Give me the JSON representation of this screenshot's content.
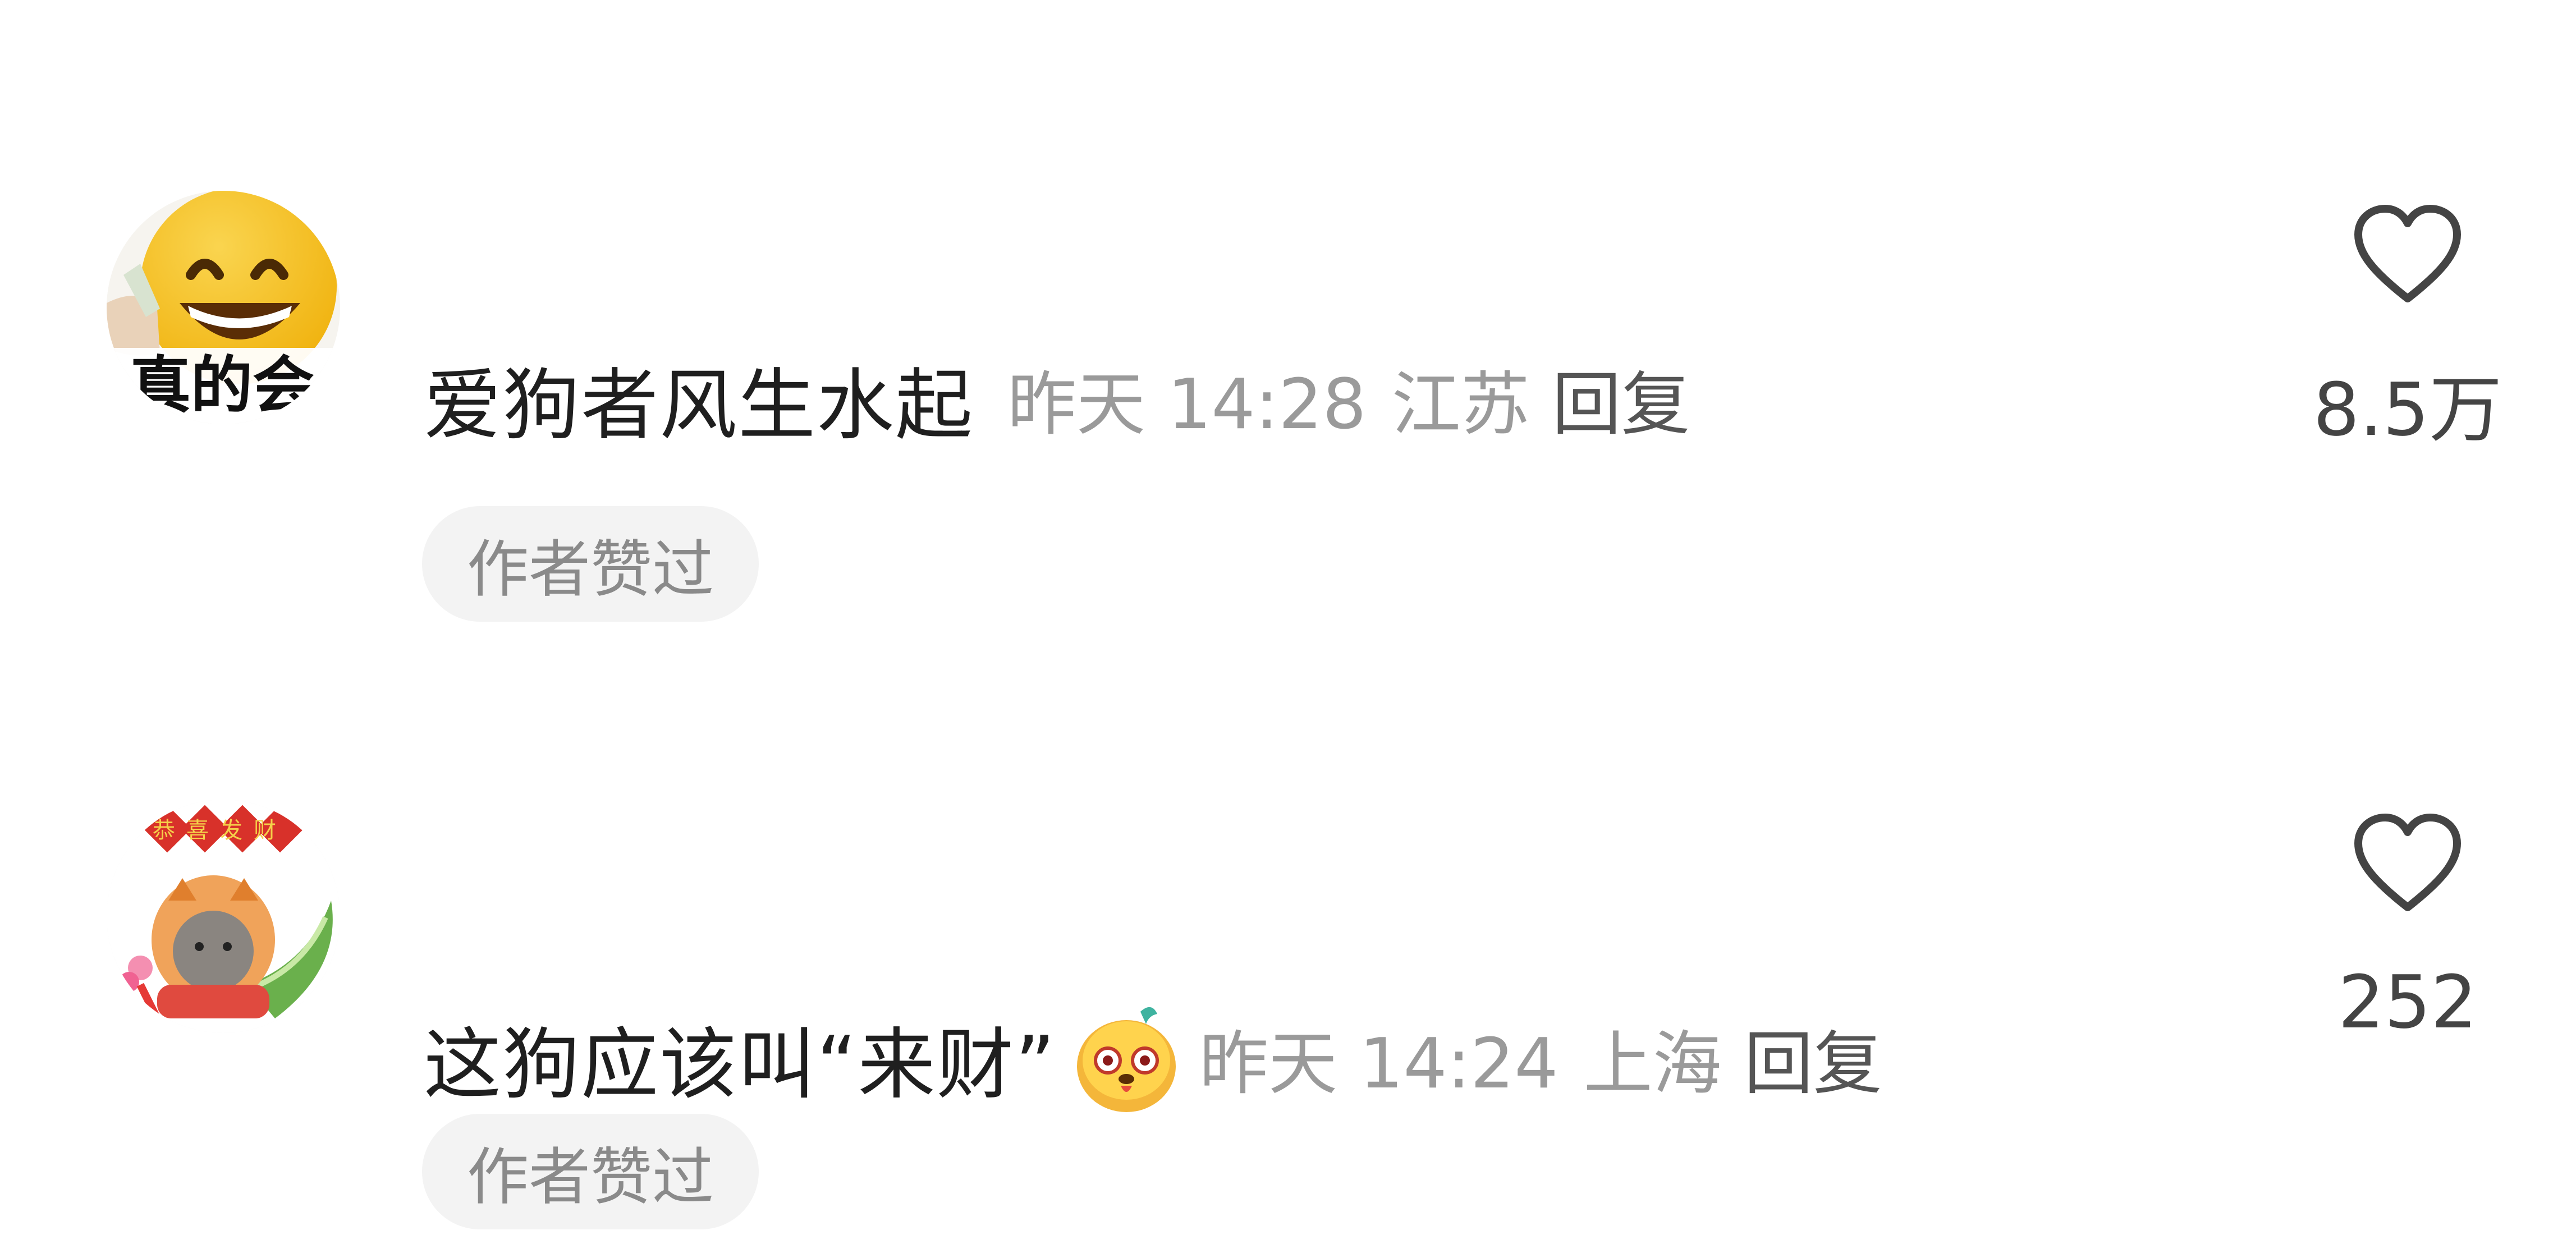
{
  "comments": [
    {
      "text": "爱狗者风生水起",
      "time": "昨天 14:28",
      "location": "江苏",
      "reply_label": "回复",
      "badge": "作者赞过",
      "likes": "8.5万",
      "avatar_text": "真的会"
    },
    {
      "text": "这狗应该叫“来财”",
      "time": "昨天 14:24",
      "location": "上海",
      "reply_label": "回复",
      "badge": "作者赞过",
      "likes": "252",
      "avatar_text": "恭喜发财"
    }
  ],
  "icons": {
    "like": "heart-outline-icon",
    "inline_emoji": "yellow-dog-face-emoji"
  },
  "colors": {
    "text": "#1f1f1f",
    "meta": "#9a9a9a",
    "reply": "#555555",
    "badge_bg": "#f3f3f3",
    "badge_text": "#8a8a8a",
    "icon": "#444444"
  }
}
